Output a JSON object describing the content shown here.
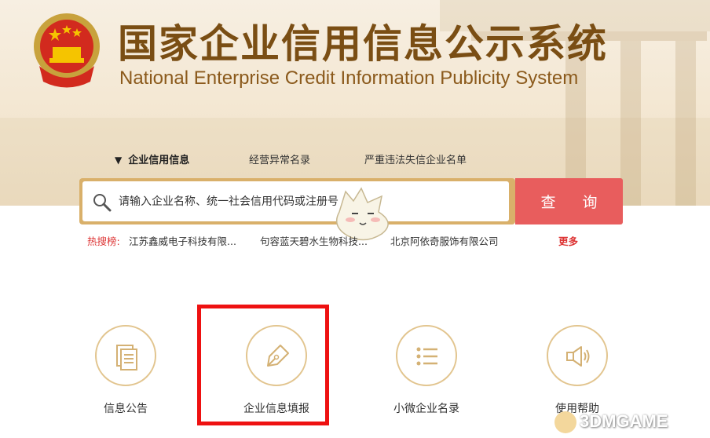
{
  "header": {
    "title_cn": "国家企业信用信息公示系统",
    "title_en": "National Enterprise Credit Information Publicity System"
  },
  "nav": {
    "tabs": [
      {
        "label": "企业信用信息",
        "active": true
      },
      {
        "label": "经营异常名录",
        "active": false
      },
      {
        "label": "严重违法失信企业名单",
        "active": false
      }
    ]
  },
  "search": {
    "placeholder": "请输入企业名称、统一社会信用代码或注册号",
    "button_label": "查 询"
  },
  "hot_search": {
    "label": "热搜榜:",
    "items": [
      "江苏鑫威电子科技有限...",
      "句容蓝天碧水生物科技...",
      "北京阿依奇服饰有限公司"
    ],
    "more_label": "更多"
  },
  "features": [
    {
      "label": "信息公告",
      "icon": "notice-icon"
    },
    {
      "label": "企业信息填报",
      "icon": "pen-nib-icon"
    },
    {
      "label": "小微企业名录",
      "icon": "list-icon"
    },
    {
      "label": "使用帮助",
      "icon": "speaker-icon"
    }
  ],
  "highlight_color": "#ee1111",
  "accent_color": "#e85d5d",
  "watermark": {
    "text": "3DMGAME"
  }
}
